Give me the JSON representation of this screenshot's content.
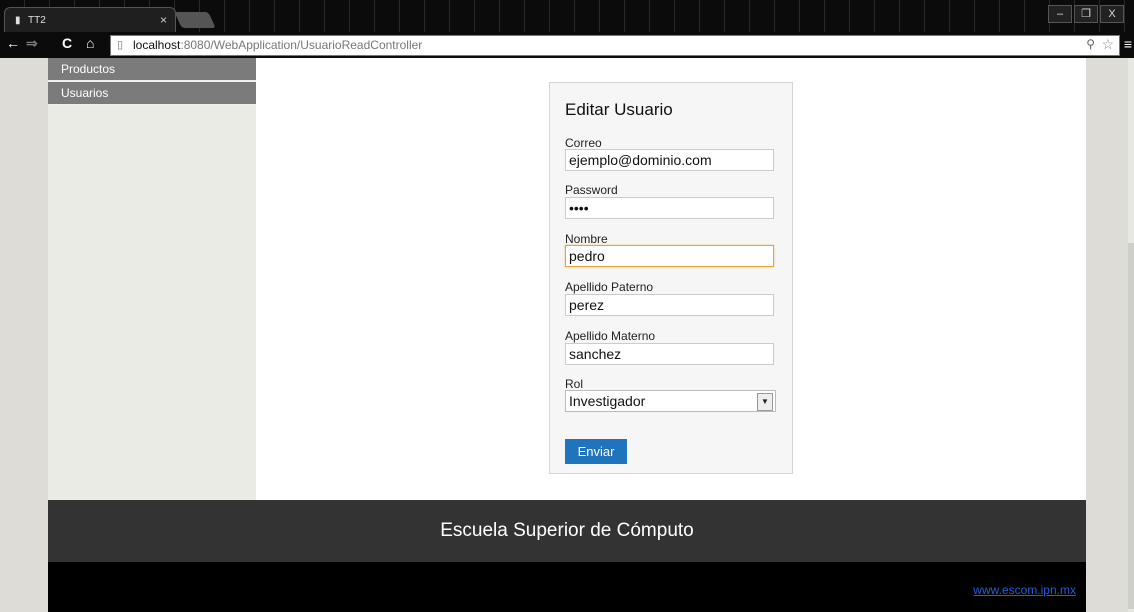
{
  "browser": {
    "tab_title": "TT2",
    "tab_close": "×",
    "url_host": "localhost",
    "url_path": ":8080/WebApplication/UsuarioReadController",
    "window_controls": [
      "–",
      "❐",
      "X"
    ]
  },
  "sidebar": {
    "items": [
      {
        "label": "Productos"
      },
      {
        "label": "Usuarios"
      }
    ]
  },
  "form": {
    "title": "Editar Usuario",
    "fields": {
      "correo": {
        "label": "Correo",
        "value": "ejemplo@dominio.com"
      },
      "password": {
        "label": "Password",
        "value": "••••"
      },
      "nombre": {
        "label": "Nombre",
        "value": "pedro"
      },
      "apellido_paterno": {
        "label": "Apellido Paterno",
        "value": "perez"
      },
      "apellido_materno": {
        "label": "Apellido Materno",
        "value": "sanchez"
      },
      "rol": {
        "label": "Rol",
        "value": "Investigador"
      }
    },
    "submit_label": "Enviar"
  },
  "footer": {
    "title": "Escuela Superior de Cómputo",
    "link": "www.escom.ipn.mx"
  },
  "colors": {
    "submit_button": "#1f74bd",
    "footer_dark": "#333333",
    "sidebar_item": "#7b7b7b",
    "focus_border": "#e3a63e"
  }
}
